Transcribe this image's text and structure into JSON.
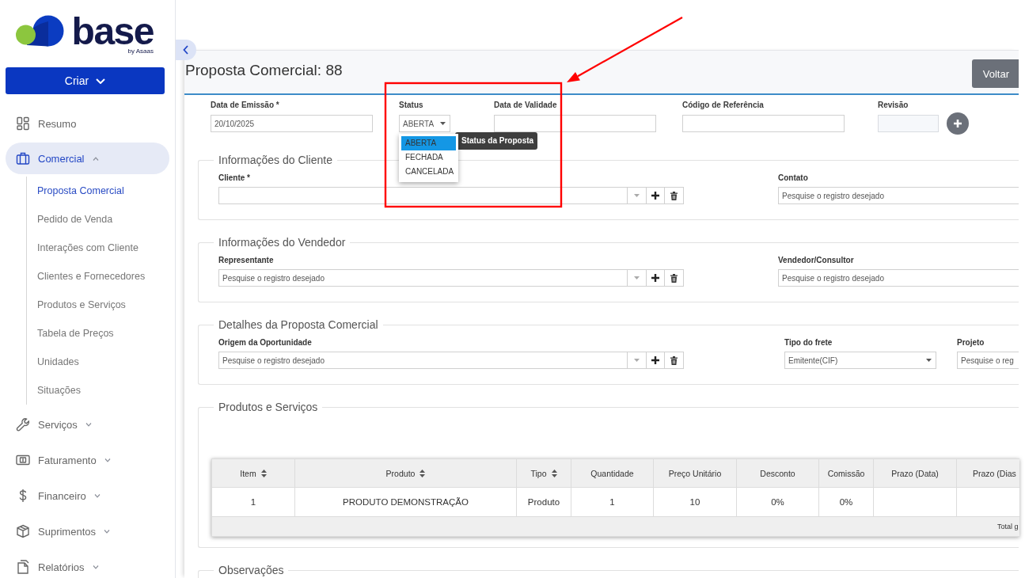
{
  "sidebar": {
    "logo": {
      "wordmark": "base",
      "tagline": "by Asaas"
    },
    "create_button": "Criar",
    "nav": [
      {
        "kind": "link",
        "label": "Resumo",
        "selected": false
      },
      {
        "kind": "group",
        "label": "Comercial",
        "selected": true,
        "expanded": true,
        "children": [
          {
            "label": "Proposta Comercial",
            "selected": true
          },
          {
            "label": "Pedido de Venda",
            "selected": false
          },
          {
            "label": "Interações com Cliente",
            "selected": false
          },
          {
            "label": "Clientes e Fornecedores",
            "selected": false
          },
          {
            "label": "Produtos e Serviços",
            "selected": false
          },
          {
            "label": "Tabela de Preços",
            "selected": false
          },
          {
            "label": "Unidades",
            "selected": false
          },
          {
            "label": "Situações",
            "selected": false
          }
        ]
      },
      {
        "kind": "group",
        "label": "Serviços",
        "selected": false,
        "expanded": false
      },
      {
        "kind": "group",
        "label": "Faturamento",
        "selected": false,
        "expanded": false
      },
      {
        "kind": "group",
        "label": "Financeiro",
        "selected": false,
        "expanded": false
      },
      {
        "kind": "group",
        "label": "Suprimentos",
        "selected": false,
        "expanded": false
      },
      {
        "kind": "group",
        "label": "Relatórios",
        "selected": false,
        "expanded": false
      }
    ]
  },
  "page": {
    "title": "Proposta Comercial: 88",
    "back_button": "Voltar"
  },
  "general": [
    {
      "kind": "input",
      "label": "Data de Emissão *",
      "value": "20/10/2025"
    },
    {
      "kind": "select",
      "label": "Status",
      "value": "ABERTA",
      "expanded": true,
      "options": [
        {
          "label": "ABERTA",
          "selected": true
        },
        {
          "label": "FECHADA",
          "selected": false
        },
        {
          "label": "CANCELADA",
          "selected": false
        }
      ],
      "tooltip": "Status da Proposta"
    },
    {
      "kind": "input",
      "label": "Data de Validade"
    },
    {
      "kind": "input",
      "label": "Código de Referência"
    },
    {
      "kind": "input",
      "label": "Revisão",
      "disabled": true
    }
  ],
  "sections": [
    {
      "legend": "Informações do Cliente",
      "fields": [
        {
          "kind": "lookup",
          "label": "Cliente *"
        },
        {
          "kind": "search",
          "label": "Contato",
          "placeholder": "Pesquise o registro desejado"
        }
      ]
    },
    {
      "legend": "Informações do Vendedor",
      "fields": [
        {
          "kind": "lookup",
          "label": "Representante",
          "placeholder": "Pesquise o registro desejado"
        },
        {
          "kind": "search",
          "label": "Vendedor/Consultor",
          "placeholder": "Pesquise o registro desejado"
        }
      ]
    },
    {
      "legend": "Detalhes da Proposta Comercial",
      "fields": [
        {
          "kind": "lookup",
          "label": "Origem da Oportunidade",
          "placeholder": "Pesquise o registro desejado"
        },
        {
          "kind": "select",
          "label": "Tipo do frete",
          "value": "Emitente(CIF)"
        },
        {
          "kind": "search",
          "label": "Projeto",
          "placeholder": "Pesquise o reg"
        }
      ]
    }
  ],
  "products": {
    "legend": "Produtos e Serviços",
    "table": {
      "columns": [
        {
          "label": "Item",
          "sortable": true
        },
        {
          "label": "Produto",
          "sortable": true
        },
        {
          "label": "Tipo",
          "sortable": true
        },
        {
          "label": "Quantidade",
          "sortable": false
        },
        {
          "label": "Preço Unitário",
          "sortable": false
        },
        {
          "label": "Desconto",
          "sortable": false
        },
        {
          "label": "Comissão",
          "sortable": false
        },
        {
          "label": "Prazo (Data)",
          "sortable": false
        },
        {
          "label": "Prazo (Dias",
          "sortable": false
        }
      ],
      "rows": [
        {
          "cells": [
            "1",
            "PRODUTO DEMONSTRAÇÃO",
            "Produto",
            "1",
            "10",
            "0%",
            "0%"
          ]
        }
      ],
      "footer": "Total g"
    }
  },
  "observations": {
    "legend": "Observações"
  },
  "annotations": [
    {
      "kind": "frame"
    },
    {
      "kind": "arrow"
    }
  ]
}
